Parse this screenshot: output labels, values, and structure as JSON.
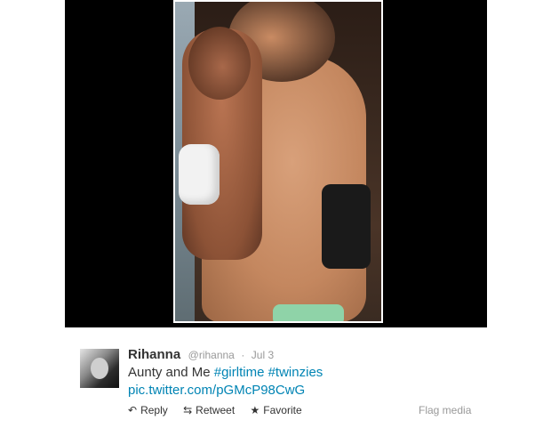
{
  "tweet": {
    "author_name": "Rihanna",
    "handle": "@rihanna",
    "separator": "·",
    "date": "Jul 3",
    "text_prefix": "Aunty and Me",
    "hashtags": [
      "#girltime",
      "#twinzies"
    ],
    "link": "pic.twitter.com/pGMcP98CwG"
  },
  "actions": {
    "reply": "Reply",
    "retweet": "Retweet",
    "favorite": "Favorite",
    "flag_media": "Flag media"
  },
  "icons": {
    "reply": "reply-arrow-icon",
    "retweet": "retweet-icon",
    "favorite": "star-icon"
  },
  "colors": {
    "link": "#0084b4",
    "muted": "#999999",
    "text": "#333333",
    "media_background": "#000000"
  }
}
